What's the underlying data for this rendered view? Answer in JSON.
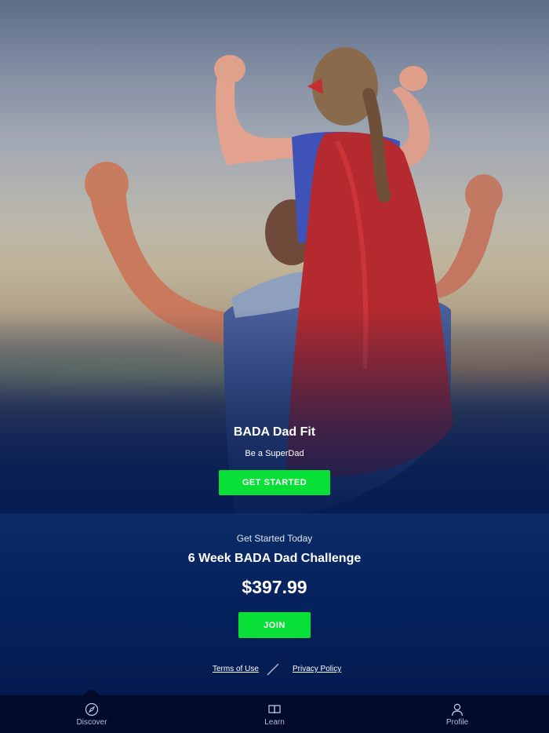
{
  "hero": {
    "title": "BADA Dad Fit",
    "subtitle": "Be a SuperDad",
    "cta_label": "GET STARTED",
    "image_description_icon": "superhero-dad-photo"
  },
  "offer": {
    "kicker": "Get Started Today",
    "title": "6 Week BADA Dad Challenge",
    "price": "$397.99",
    "join_label": "JOIN"
  },
  "legal": {
    "terms_label": "Terms of Use",
    "privacy_label": "Privacy Policy"
  },
  "tabs": [
    {
      "label": "Discover",
      "icon": "compass-icon",
      "active": true
    },
    {
      "label": "Learn",
      "icon": "book-icon",
      "active": false
    },
    {
      "label": "Profile",
      "icon": "person-icon",
      "active": false
    }
  ],
  "colors": {
    "accent_green": "#08e038",
    "section_blue": "#062461",
    "tabbar_bg": "#010a2a"
  }
}
